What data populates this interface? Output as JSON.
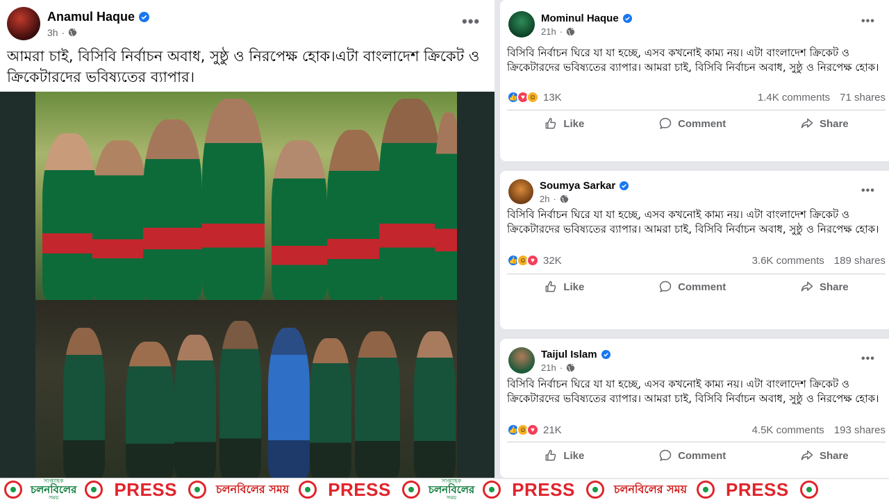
{
  "left_post": {
    "author": "Anamul Haque",
    "time": "3h",
    "text": "আমরা চাই, বিসিবি নির্বাচন অবাধ,  সুষ্ঠু ও নিরপেক্ষ হোক।এটা বাংলাদেশ ক্রিকেট ও ক্রিকেটারদের ভবিষ্যতের ব্যাপার।"
  },
  "right_posts": [
    {
      "author": "Mominul Haque",
      "time": "21h",
      "text": "বিসিবি নির্বাচন ঘিরে যা যা হচ্ছে, এসব কখনোই কাম্য নয়। এটা বাংলাদেশ ক্রিকেট ও ক্রিকেটারদের ভবিষ্যতের ব্যাপার। আমরা চাই, বিসিবি নির্বাচন অবাধ,  সুষ্ঠু ও নিরপেক্ষ হোক।",
      "reaction_count": "13K",
      "comments": "1.4K comments",
      "shares": "71 shares"
    },
    {
      "author": "Soumya Sarkar",
      "time": "2h",
      "text": "বিসিবি নির্বাচন ঘিরে যা যা হচ্ছে, এসব কখনোই কাম্য নয়। এটা বাংলাদেশ ক্রিকেট ও ক্রিকেটারদের ভবিষ্যতের ব্যাপার। আমরা চাই, বিসিবি নির্বাচন অবাধ,  সুষ্ঠু ও নিরপেক্ষ হোক।",
      "reaction_count": "32K",
      "comments": "3.6K comments",
      "shares": "189 shares"
    },
    {
      "author": "Taijul Islam",
      "time": "21h",
      "text": "বিসিবি নির্বাচন ঘিরে যা যা হচ্ছে, এসব কখনোই কাম্য নয়। এটা বাংলাদেশ ক্রিকেট ও ক্রিকেটারদের ভবিষ্যতের ব্যাপার। আমরা চাই, বিসিবি নির্বাচন অবাধ,  সুষ্ঠু ও নিরপেক্ষ হোক।",
      "reaction_count": "21K",
      "comments": "4.5K comments",
      "shares": "193 shares"
    }
  ],
  "actions": {
    "like": "Like",
    "comment": "Comment",
    "share": "Share"
  },
  "banner": {
    "press": "PRESS",
    "logo_large": "চলনবিলের সময়",
    "logo_small_top": "সাপ্তাহিক",
    "logo_small_main": "চলনবিলের",
    "logo_small_sub": "সময়"
  },
  "colors": {
    "facebook_blue": "#1877f2",
    "press_red": "#e0242b",
    "logo_green": "#0a7a3a"
  }
}
